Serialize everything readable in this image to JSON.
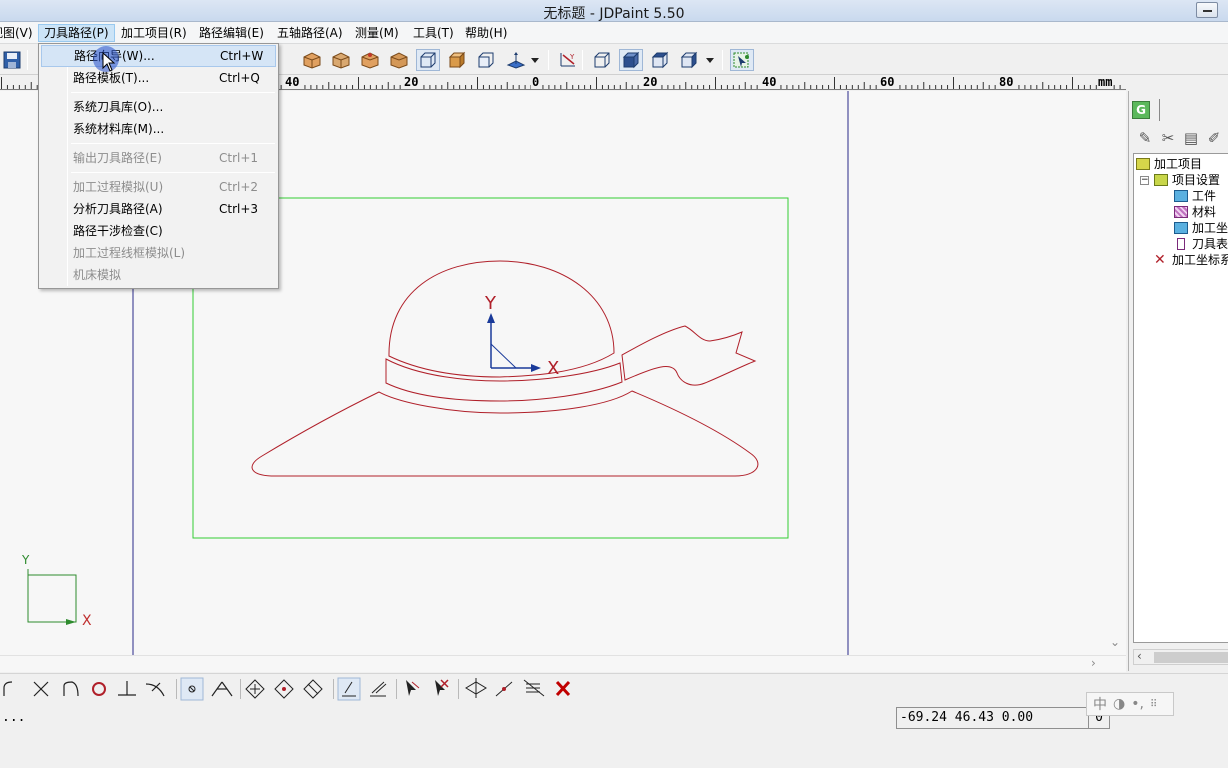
{
  "window": {
    "title": "无标题 - JDPaint 5.50"
  },
  "menubar": {
    "items": [
      {
        "label": "视图(V)",
        "active": false
      },
      {
        "label": "刀具路径(P)",
        "active": true
      },
      {
        "label": "加工项目(R)",
        "active": false
      },
      {
        "label": "路径编辑(E)",
        "active": false
      },
      {
        "label": "五轴路径(A)",
        "active": false
      },
      {
        "label": "测量(M)",
        "active": false
      },
      {
        "label": "工具(T)",
        "active": false
      },
      {
        "label": "帮助(H)",
        "active": false
      }
    ]
  },
  "dropdown": {
    "items": [
      {
        "label": "路径向导(W)...",
        "shortcut": "Ctrl+W",
        "enabled": true,
        "highlighted": true
      },
      {
        "label": "路径模板(T)...",
        "shortcut": "Ctrl+Q",
        "enabled": true,
        "highlighted": false
      },
      {
        "label": "系统刀具库(O)...",
        "shortcut": "",
        "enabled": true,
        "highlighted": false
      },
      {
        "label": "系统材料库(M)...",
        "shortcut": "",
        "enabled": true,
        "highlighted": false
      },
      {
        "label": "输出刀具路径(E)",
        "shortcut": "Ctrl+1",
        "enabled": false,
        "highlighted": false
      },
      {
        "label": "加工过程模拟(U)",
        "shortcut": "Ctrl+2",
        "enabled": false,
        "highlighted": false
      },
      {
        "label": "分析刀具路径(A)",
        "shortcut": "Ctrl+3",
        "enabled": true,
        "highlighted": false
      },
      {
        "label": "路径干涉检查(C)",
        "shortcut": "",
        "enabled": true,
        "highlighted": false
      },
      {
        "label": "加工过程线框模拟(L)",
        "shortcut": "",
        "enabled": false,
        "highlighted": false
      },
      {
        "label": "机床模拟",
        "shortcut": "",
        "enabled": false,
        "highlighted": false
      }
    ]
  },
  "ruler": {
    "labels": [
      "40",
      "20",
      "0",
      "20",
      "40",
      "60",
      "80"
    ],
    "unit": "mm"
  },
  "canvas": {
    "axis_x": "X",
    "axis_y": "Y",
    "corner_axis_x": "X",
    "corner_axis_y": "Y"
  },
  "tree": {
    "items": [
      {
        "label": "加工项目",
        "icon": "project-icon"
      },
      {
        "label": "项目设置",
        "icon": "settings-icon"
      },
      {
        "label": "工件",
        "icon": "workpiece-icon"
      },
      {
        "label": "材料",
        "icon": "material-icon"
      },
      {
        "label": "加工坐",
        "icon": "coordinate-icon"
      },
      {
        "label": "刀具表",
        "icon": "tool-table-icon"
      },
      {
        "label": "加工坐标系",
        "icon": "coord-system-icon"
      }
    ]
  },
  "status": {
    "message": "...",
    "coordinates": "-69.24 46.43 0.00",
    "extra": "0"
  },
  "ime": {
    "label": "中"
  },
  "colors": {
    "toolpath": "#b0202a",
    "workpiece": "#33cc33",
    "axis": "#1a3a9a",
    "guide": "#2a2a8a"
  }
}
